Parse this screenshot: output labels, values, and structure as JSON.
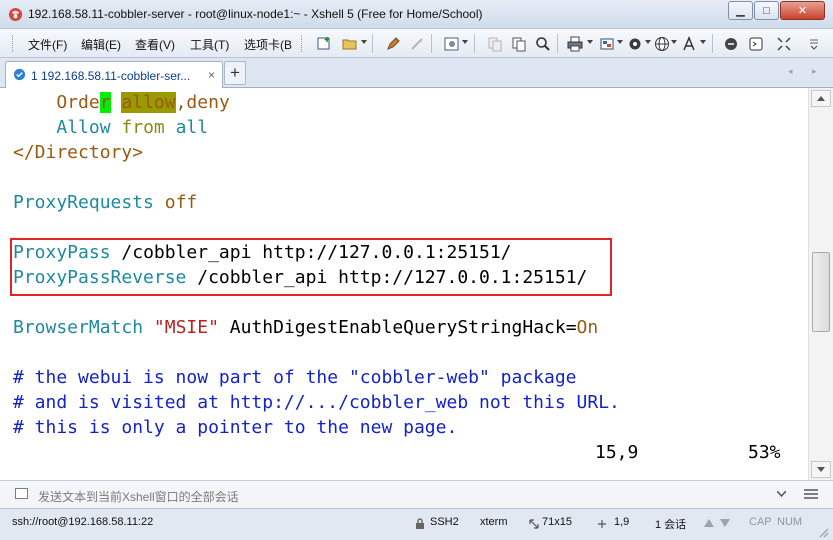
{
  "window": {
    "title": "192.168.58.11-cobbler-server - root@linux-node1:~ - Xshell 5 (Free for Home/School)",
    "minimize_label": "▁",
    "maximize_label": "□",
    "close_label": "✕"
  },
  "menu": {
    "file": "文件(F)",
    "edit": "编辑(E)",
    "view": "查看(V)",
    "tools": "工具(T)",
    "tabs": "选项卡(B"
  },
  "tab": {
    "label": "1 192.168.58.11-cobbler-ser...",
    "close": "×",
    "add": "+",
    "nav_left": "◂",
    "nav_right": "▸"
  },
  "terminal": {
    "lines": {
      "l1": {
        "a": "Orde",
        "b": "r",
        "c": " ",
        "d": "allow",
        "e": ",deny"
      },
      "l2": {
        "a": "Allow",
        "b": "from",
        "c": "all"
      },
      "l3": "</Directory>",
      "l5": {
        "a": "ProxyRequests",
        "b": "off"
      },
      "l7": {
        "a": "ProxyPass",
        "b": "/cobbler_api http://127.0.0.1:25151/"
      },
      "l8": {
        "a": "ProxyPassReverse",
        "b": "/cobbler_api http://127.0.0.1:25151/"
      },
      "l10": {
        "a": "BrowserMatch",
        "b": "\"MSIE\"",
        "c": "AuthDigestEnableQueryStringHack=",
        "d": "On"
      },
      "l12": "# the webui is now part of the \"cobbler-web\" package",
      "l13": "# and is visited at http://.../cobbler_web not this URL.",
      "l14": "# this is only a pointer to the new page."
    },
    "cursor_position": "15,9",
    "scroll_percent": "53%"
  },
  "scroll_position": 0.53,
  "input_bar": {
    "placeholder": "发送文本到当前Xshell窗口的全部会话"
  },
  "status": {
    "connection": "ssh://root@192.168.58.11:22",
    "protocol": "SSH2",
    "terminal_type": "xterm",
    "size": "71x15",
    "cursor": "1,9",
    "sessions": "1 会话",
    "caps": "CAP",
    "num": "NUM"
  },
  "colors": {
    "keyword": "#1d8a9e",
    "value": "#9a5a12",
    "comment": "#1323c7",
    "highlight_green": "#00ee00",
    "highlight_olive": "#999900",
    "annotation_box": "#e02424"
  }
}
